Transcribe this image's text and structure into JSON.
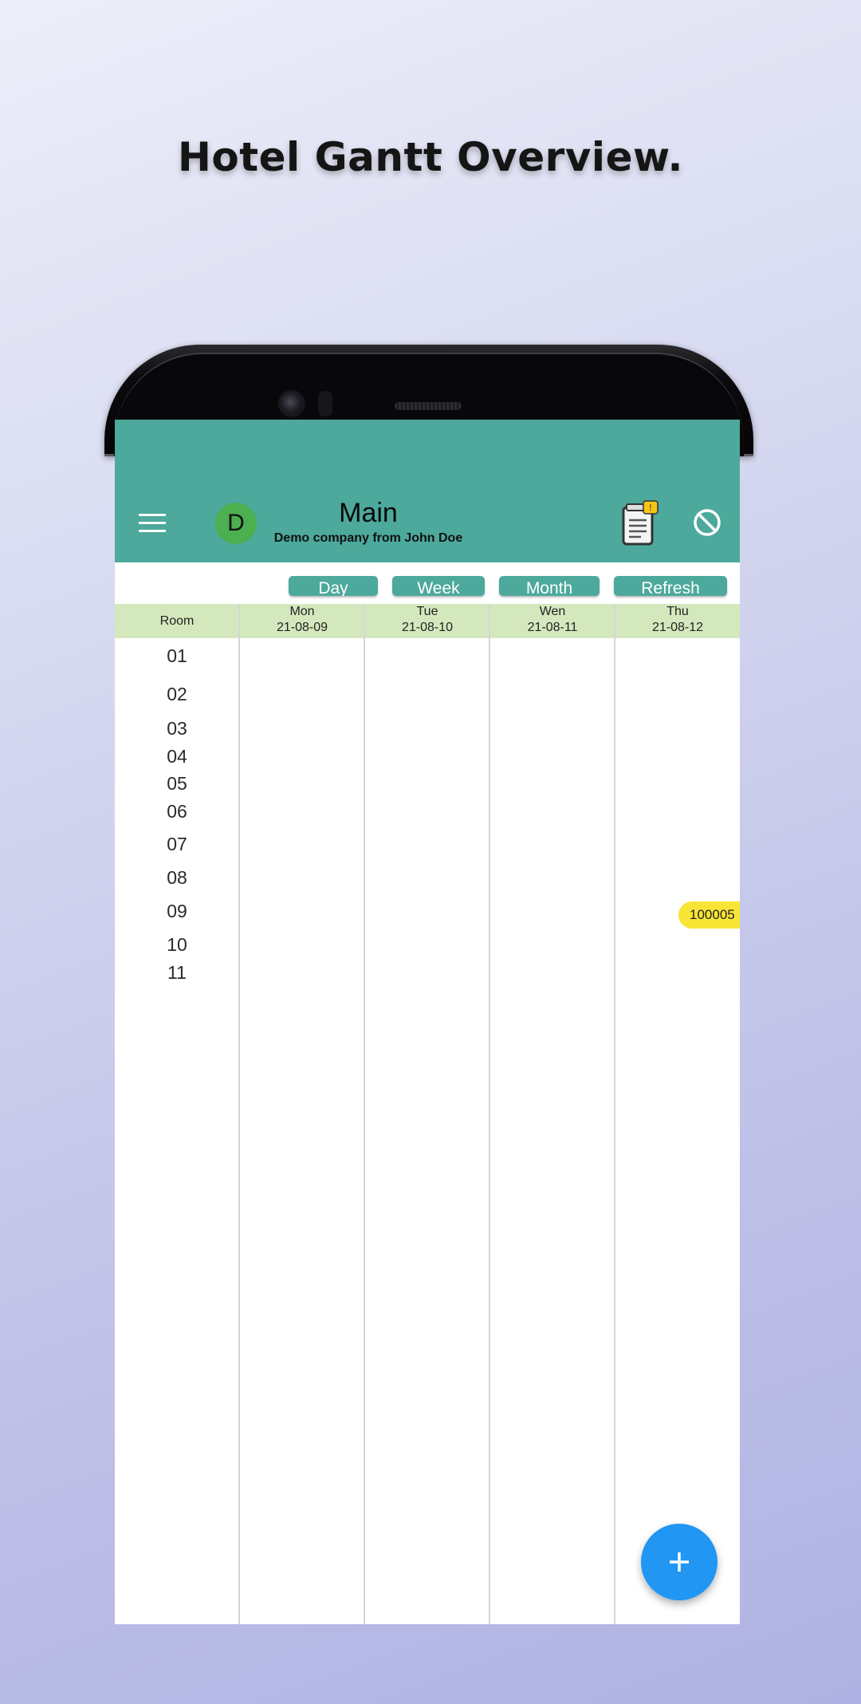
{
  "promo": {
    "title": "Hotel Gantt Overview."
  },
  "appbar": {
    "avatar_letter": "D",
    "title": "Main",
    "subtitle": "Demo company from John Doe",
    "icons": [
      "menu-icon",
      "clipboard-notification-icon",
      "block-icon"
    ]
  },
  "view_buttons": [
    "Day",
    "Week",
    "Month",
    "Refresh"
  ],
  "grid": {
    "room_header": "Room",
    "days": [
      {
        "day": "Mon",
        "date": "21-08-09"
      },
      {
        "day": "Tue",
        "date": "21-08-10"
      },
      {
        "day": "Wen",
        "date": "21-08-11"
      },
      {
        "day": "Thu",
        "date": "21-08-12"
      }
    ],
    "rooms": [
      "01",
      "02",
      "03",
      "04",
      "05",
      "06",
      "07",
      "08",
      "09",
      "10",
      "11"
    ]
  },
  "bookings": [
    {
      "label": "100005",
      "room": "09",
      "start_day": "Thu",
      "color": "#f8e536"
    }
  ],
  "fab": {
    "icon": "plus-icon"
  },
  "colors": {
    "primary": "#4ca99c",
    "header_row": "#d4e8bd",
    "avatar": "#4caf50",
    "fab": "#2196f3"
  }
}
